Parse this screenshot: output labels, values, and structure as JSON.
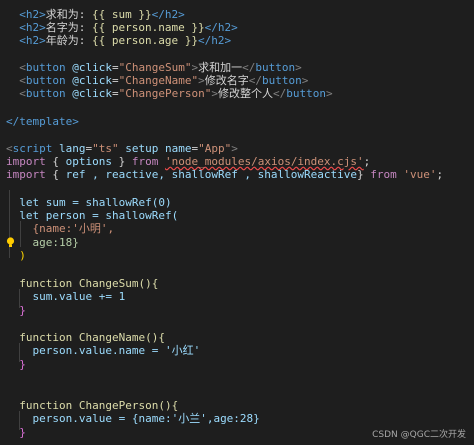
{
  "template_lines": [
    {
      "open": "<h2>",
      "label": "求和为: ",
      "expr": "{{ sum }}",
      "close": "</h2>"
    },
    {
      "open": "<h2>",
      "label": "名字为: ",
      "expr": "{{ person.name }}",
      "close": "</h2>"
    },
    {
      "open": "<h2>",
      "label": "年龄为: ",
      "expr": "{{ person.age }}",
      "close": "</h2>"
    }
  ],
  "buttons": [
    {
      "handler": "ChangeSum",
      "label": "求和加一"
    },
    {
      "handler": "ChangeName",
      "label": "修改名字"
    },
    {
      "handler": "ChangePerson",
      "label": "修改整个人"
    }
  ],
  "template_close": "</template>",
  "script_tag": {
    "lang": "ts",
    "name": "App"
  },
  "import1": {
    "names": "options",
    "from": "'node_modules/axios/index.cjs'"
  },
  "import2": {
    "names": "ref , reactive, shallowRef , shallowReactive",
    "from": "'vue'"
  },
  "code": {
    "sum_decl": "let sum = shallowRef(0)",
    "person_decl": "let person = shallowRef(",
    "person_name": "{name:'小明',",
    "person_age": "age:18}",
    "person_end": ")",
    "fn1_head": "function ChangeSum(){",
    "fn1_body": "sum.value += 1",
    "fn2_head": "function ChangeName(){",
    "fn2_body": "person.value.name = '小红'",
    "fn3_head": "function ChangePerson(){",
    "fn3_body": "person.value = {name:'小兰',age:28}",
    "brace_close": "}"
  },
  "watermark": "CSDN @QGC二次开发",
  "colors": {
    "background": "#1e1e1e",
    "keyword": "#569cd6",
    "string": "#ce9178",
    "function": "#dcdcaa",
    "variable": "#9cdcfe",
    "number": "#b5cea8",
    "import_keyword": "#c586c0"
  },
  "icons": {
    "lightbulb": "lightbulb-icon"
  }
}
